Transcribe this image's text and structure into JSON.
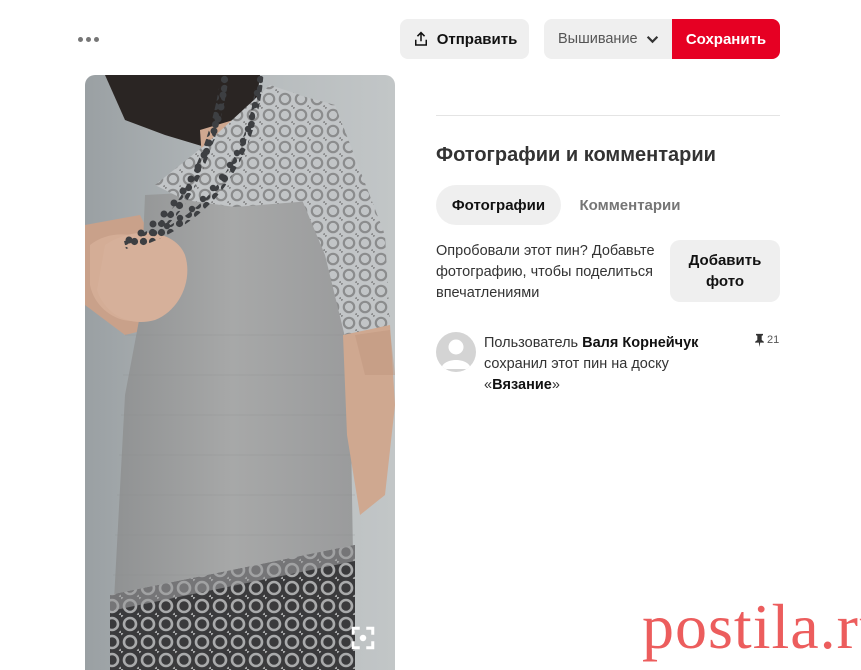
{
  "header": {
    "more_icon": "ellipsis-icon",
    "send_button": {
      "icon": "upload-icon",
      "label": "Отправить"
    },
    "board_select": {
      "value": "Вышивание",
      "icon": "chevron-down-icon"
    },
    "save_button": {
      "label": "Сохранить"
    }
  },
  "pin": {
    "expand_icon": "expand-icon"
  },
  "colors": {
    "accent": "#e60023",
    "button_bg": "#efefef",
    "text": "#333333",
    "muted": "#767676",
    "watermark": "#e83a3a"
  },
  "details": {
    "section_title": "Фотографии и комментарии",
    "tabs": [
      {
        "label": "Фотографии",
        "active": true
      },
      {
        "label": "Комментарии",
        "active": false
      }
    ],
    "try_prompt": "Опробовали этот пин? Добавьте фотографию, чтобы поделиться впечатлениями",
    "add_photo_button": {
      "line1": "Добавить",
      "line2": "фото"
    },
    "activity": {
      "prefix": "Пользователь",
      "user": "Валя Корнейчук",
      "middle": "сохранил этот пин на доску",
      "open_quote": "«",
      "board": "Вязание",
      "close_quote": "»",
      "pin_icon": "pushpin-icon",
      "saves_count": "21"
    }
  },
  "watermark": {
    "text": "postila.ru"
  }
}
